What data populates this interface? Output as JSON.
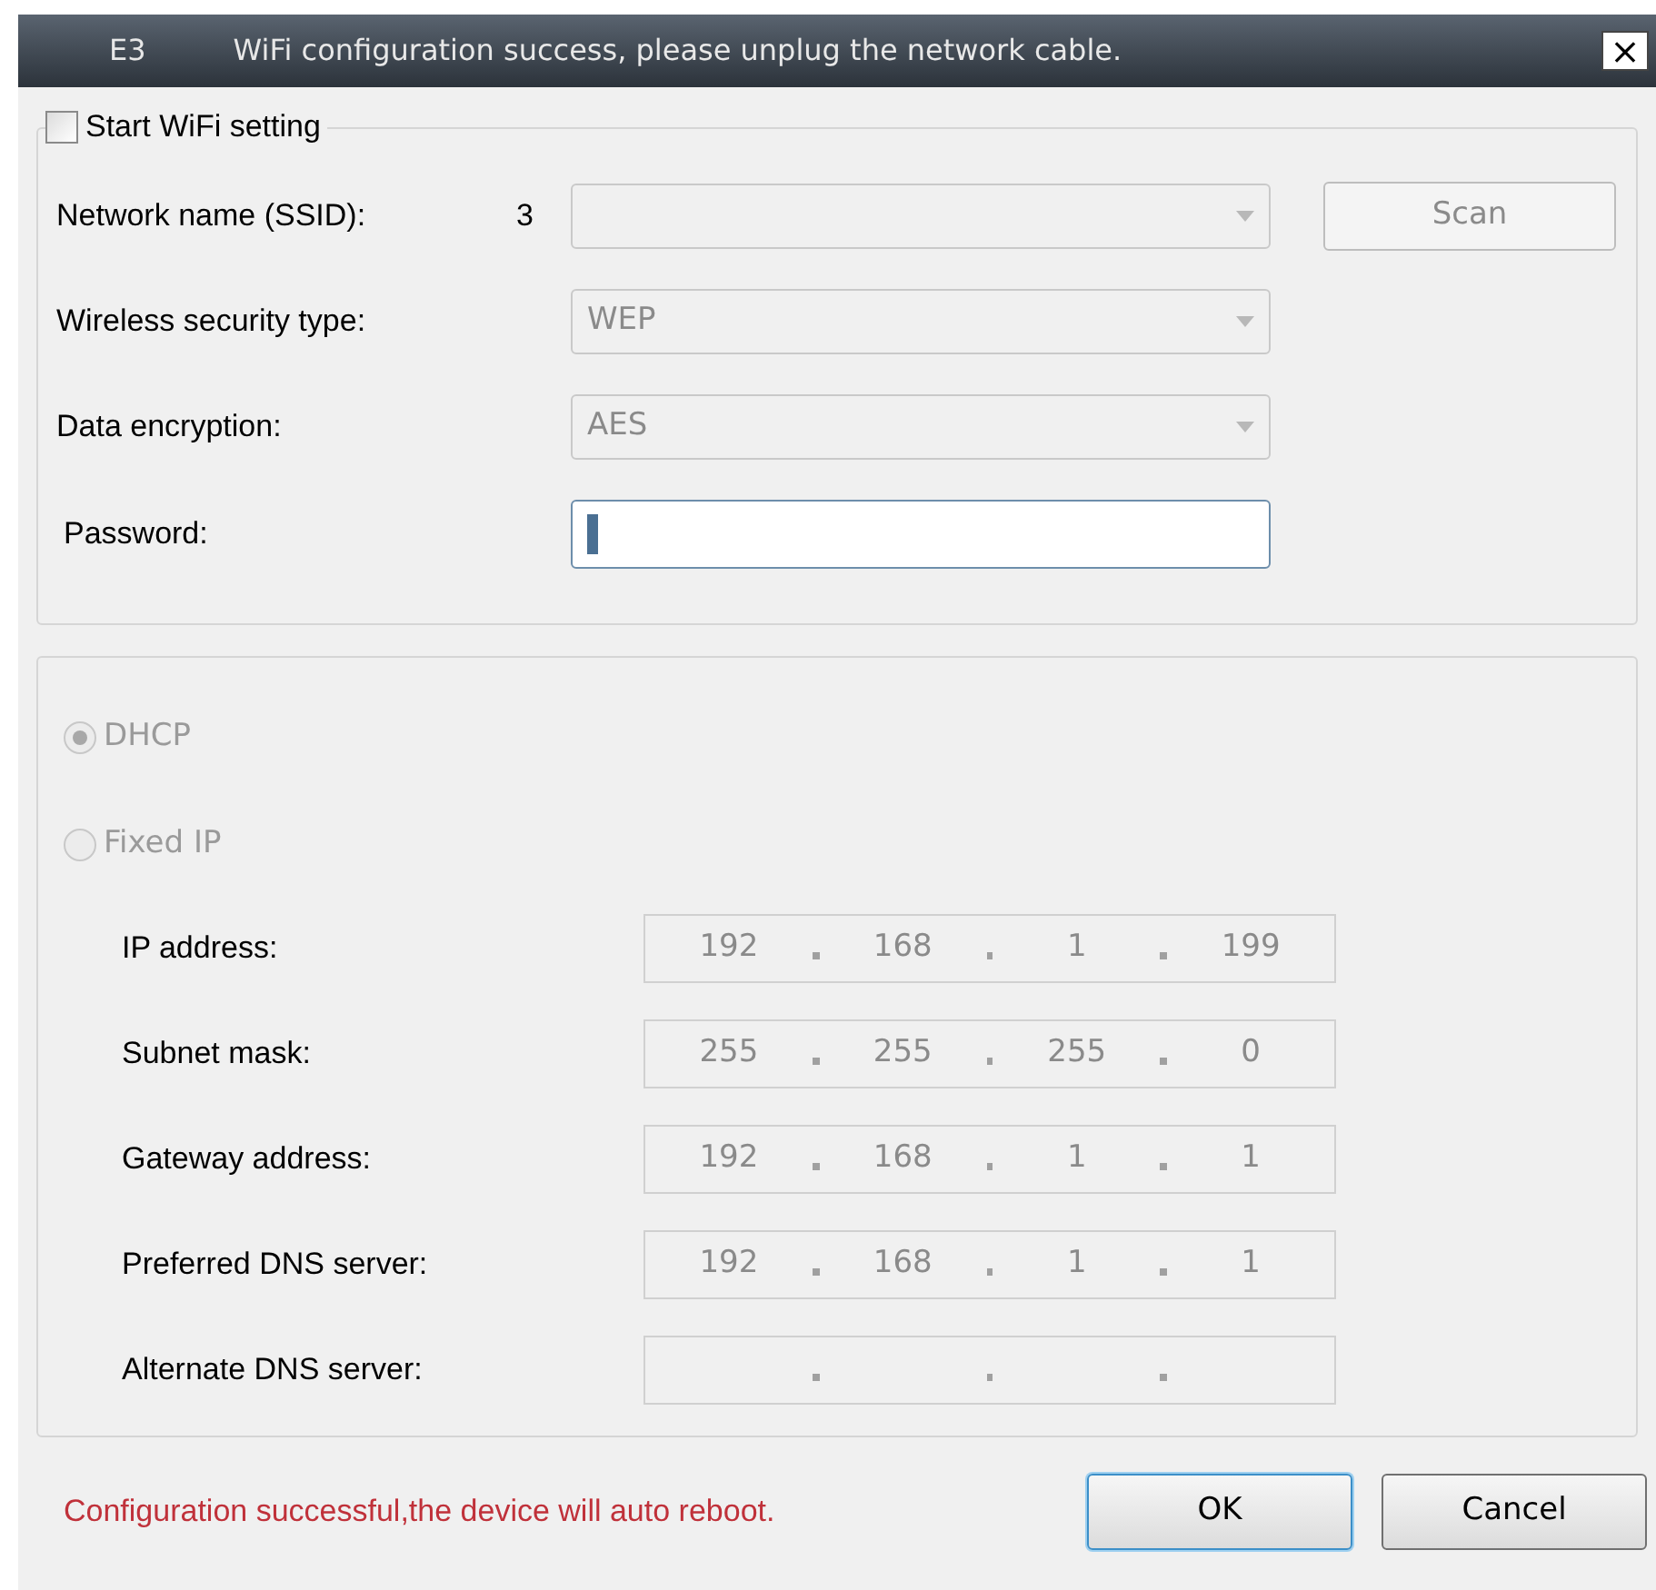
{
  "window": {
    "title_prefix": "E3",
    "title": "WiFi configuration success, please unplug the network cable.",
    "close": "×"
  },
  "wifi": {
    "label": "Start WiFi setting",
    "checked": false,
    "ssid": {
      "label": "Network name (SSID):",
      "count": "3",
      "disabled": true
    },
    "scan": {
      "label": "Scan",
      "disabled": true
    },
    "security": {
      "label": "Wireless security type:",
      "value": "WEP",
      "disabled": true
    },
    "encryption": {
      "label": "Data encryption:",
      "value": "AES",
      "disabled": true
    },
    "password": {
      "label": "Password:",
      "focused": true
    }
  },
  "ip_mode": [
    {
      "label": "DHCP",
      "selected": true,
      "disabled": true
    },
    {
      "label": "Fixed IP",
      "selected": false,
      "disabled": true
    }
  ],
  "ip_fields": [
    {
      "label": "IP address:",
      "octets": [
        "192",
        "168",
        "1",
        "199"
      ]
    },
    {
      "label": "Subnet mask:",
      "octets": [
        "255",
        "255",
        "255",
        "0"
      ]
    },
    {
      "label": "Gateway address:",
      "octets": [
        "192",
        "168",
        "1",
        "1"
      ]
    },
    {
      "label": "Preferred DNS server:",
      "octets": [
        "192",
        "168",
        "1",
        "1"
      ]
    },
    {
      "label": "Alternate DNS server:"
    }
  ],
  "status_message": "Configuration successful,the device will auto reboot.",
  "buttons": [
    {
      "label": "OK",
      "default": true
    },
    {
      "label": "Cancel",
      "default": false
    }
  ]
}
